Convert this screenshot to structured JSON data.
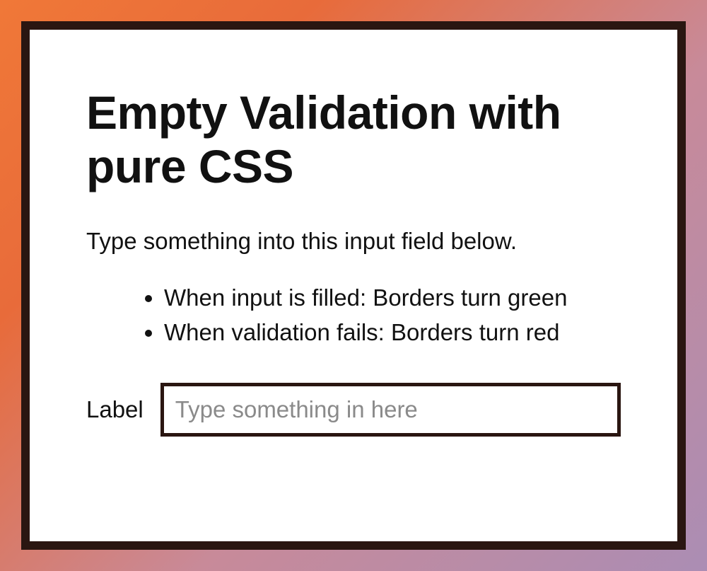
{
  "heading": "Empty Validation with pure CSS",
  "description": "Type something into this input field below.",
  "bullets": [
    "When input is filled: Borders turn green",
    "When validation fails: Borders turn red"
  ],
  "form": {
    "label": "Label",
    "placeholder": "Type something in here",
    "value": ""
  },
  "colors": {
    "card_border": "#2a1611",
    "input_border": "#2a1611",
    "placeholder": "#8a8a8a"
  }
}
